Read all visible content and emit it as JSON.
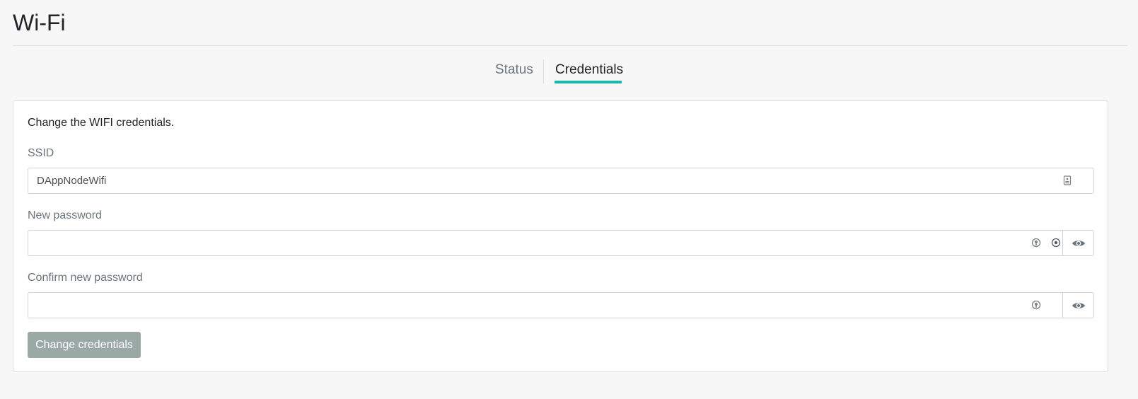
{
  "page": {
    "title": "Wi-Fi"
  },
  "tabs": [
    {
      "label": "Status",
      "active": false
    },
    {
      "label": "Credentials",
      "active": true
    }
  ],
  "colors": {
    "accent": "#1ab8aa",
    "button_disabled": "#9aa9a6"
  },
  "form": {
    "intro": "Change the WIFI credentials.",
    "ssid": {
      "label": "SSID",
      "value": "DAppNodeWifi",
      "icon": "contact-card-icon"
    },
    "new_password": {
      "label": "New password",
      "value": "",
      "icons": [
        "password-manager-icon",
        "key-icon",
        "eye-icon"
      ]
    },
    "confirm_password": {
      "label": "Confirm new password",
      "value": "",
      "icons": [
        "password-manager-icon",
        "eye-icon"
      ]
    },
    "submit_label": "Change credentials",
    "submit_disabled": true
  }
}
